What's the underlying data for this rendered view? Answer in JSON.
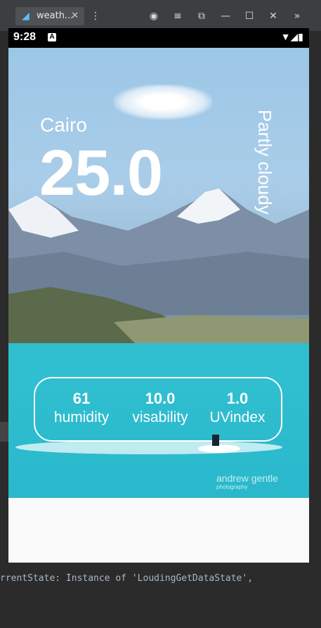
{
  "window": {
    "tab_title": "weath...",
    "tab_close": "✕",
    "controls": {
      "menu": "⋮",
      "account": "◉",
      "list": "≡",
      "screenshot": "⧉",
      "minimize": "—",
      "maximize": "☐",
      "close": "✕",
      "more": "»"
    }
  },
  "statusbar": {
    "time": "9:28",
    "indicator": "A",
    "icons": "▼◢▮"
  },
  "weather": {
    "city": "Cairo",
    "temperature": "25.0",
    "condition": "Partly cloudy",
    "stats": [
      {
        "value": "61",
        "label": "humidity"
      },
      {
        "value": "10.0",
        "label": "visability"
      },
      {
        "value": "1.0",
        "label": "UVindex"
      }
    ]
  },
  "watermark": {
    "name": "andrew gentle",
    "sub": "photography"
  },
  "ide": {
    "bottom_line": "rrentState: Instance of 'LoudingGetDataState',"
  }
}
